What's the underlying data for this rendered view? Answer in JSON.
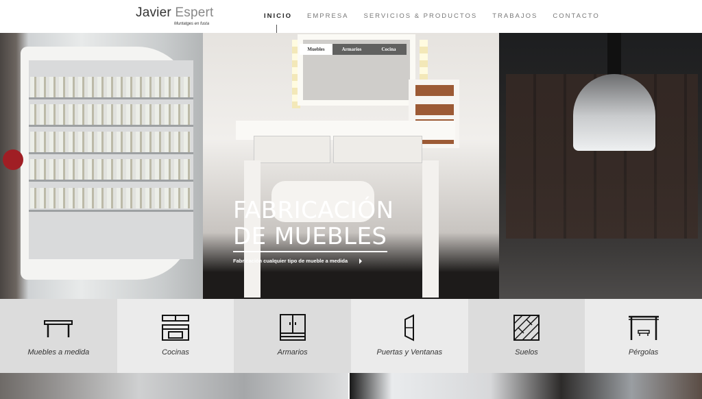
{
  "logo": {
    "name_first": "Javier",
    "name_second": "Espert",
    "tagline": "Muntatges en fusta"
  },
  "nav": {
    "items": [
      "INICIO",
      "EMPRESA",
      "SERVICIOS & PRODUCTOS",
      "TRABAJOS",
      "CONTACTO"
    ],
    "active": "INICIO"
  },
  "hero": {
    "tabs": [
      "Muebles",
      "Armarios",
      "Cocina"
    ],
    "active_tab": "Muebles",
    "title_line1": "FABRICACIÓN",
    "title_line2": "DE MUEBLES",
    "subtitle": "Fabricación cualquier tipo de mueble a medida"
  },
  "services": [
    {
      "label": "Muebles a medida",
      "icon": "table-icon"
    },
    {
      "label": "Cocinas",
      "icon": "kitchen-icon"
    },
    {
      "label": "Armarios",
      "icon": "wardrobe-icon"
    },
    {
      "label": "Puertas y Ventanas",
      "icon": "door-window-icon"
    },
    {
      "label": "Suelos",
      "icon": "floor-icon"
    },
    {
      "label": "Pérgolas",
      "icon": "pergola-icon"
    }
  ],
  "colors": {
    "tile_dark": "#dcdcdc",
    "tile_light": "#ebebeb",
    "text": "#333333"
  }
}
